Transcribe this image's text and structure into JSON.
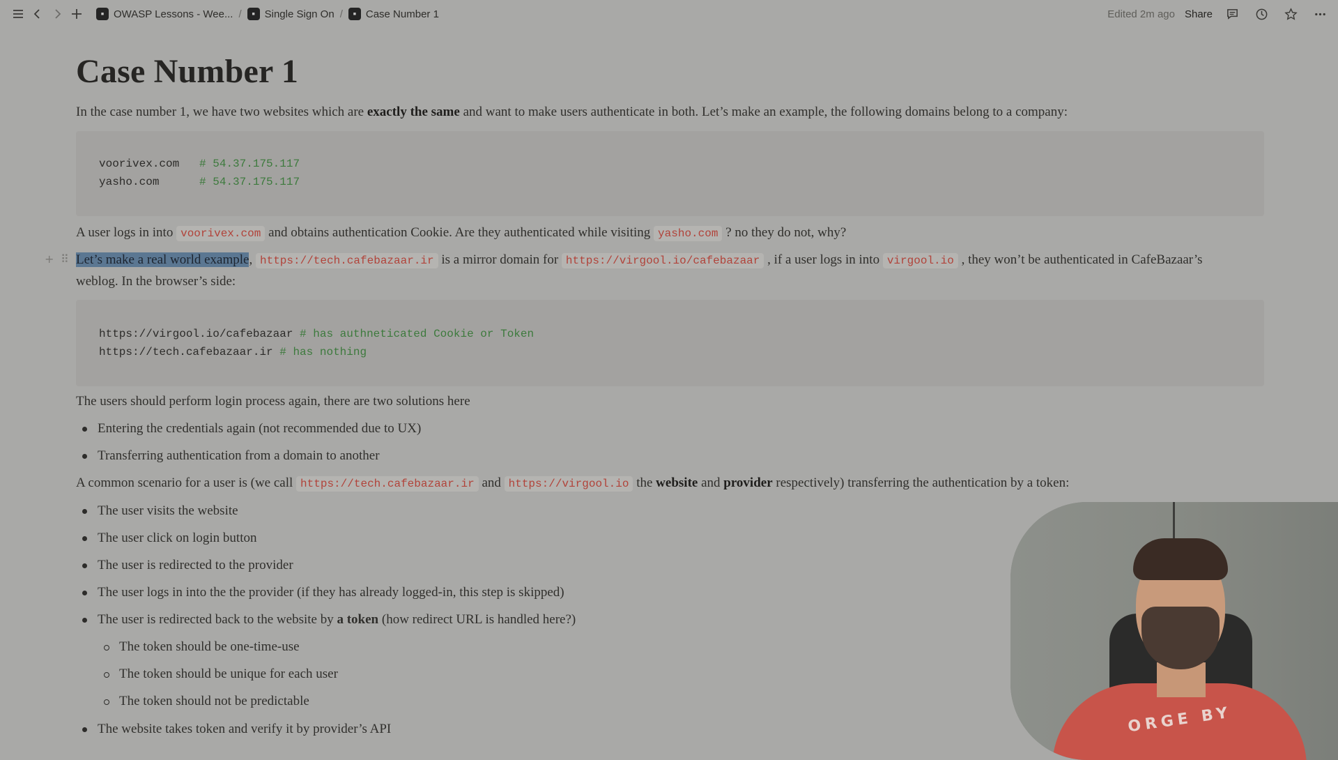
{
  "topbar": {
    "breadcrumbs": [
      {
        "icon": "notion-page-icon",
        "label": "OWASP Lessons - Wee..."
      },
      {
        "icon": "notion-page-icon",
        "label": "Single Sign On"
      },
      {
        "icon": "notion-page-icon",
        "label": "Case Number 1"
      }
    ],
    "separator": "/",
    "edited": "Edited 2m ago",
    "share": "Share",
    "icons": [
      "sidebar-toggle-icon",
      "back-icon",
      "forward-icon",
      "add-icon",
      "comments-icon",
      "history-icon",
      "favorite-star-icon",
      "more-icon"
    ]
  },
  "page": {
    "title": "Case Number 1",
    "intro": {
      "t1": "In the case number 1, we have two websites which are ",
      "b1": "exactly the same",
      "t2": " and want to make users authenticate in both. Let’s make an example, the following domains belong to a company:"
    },
    "code1": {
      "line1": {
        "code": "voorivex.com   ",
        "comment": "# 54.37.175.117"
      },
      "line2": {
        "code": "yasho.com      ",
        "comment": "# 54.37.175.117"
      }
    },
    "p2": {
      "t1": "A user logs in into ",
      "c1": "voorivex.com",
      "t2": " and obtains authentication Cookie. Are they authenticated while visiting ",
      "c2": "yasho.com",
      "t3": " ? no they do not, why?"
    },
    "p3": {
      "hl": "Let’s make a real world example",
      "t1": ", ",
      "c1": "https://tech.cafebazaar.ir",
      "t2": " is a mirror domain for ",
      "c2": "https://virgool.io/cafebazaar",
      "t3": " , if a user logs in into ",
      "c3": "virgool.io",
      "t4": " , they won’t be authenticated in CafeBazaar’s",
      "t5": "weblog. In the browser’s side:"
    },
    "code2": {
      "line1": {
        "code": "https://virgool.io/cafebazaar ",
        "comment": "# has authneticated Cookie or Token"
      },
      "line2": {
        "code": "https://tech.cafebazaar.ir ",
        "comment": "# has nothing"
      }
    },
    "p4": "The users should perform login process again, there are two solutions here",
    "list1": [
      "Entering the credentials again (not recommended due to UX)",
      "Transferring authentication from a domain to another"
    ],
    "p5": {
      "t1": "A common scenario for a user is (we call ",
      "c1": "https://tech.cafebazaar.ir",
      "t2": " and ",
      "c2": "https://virgool.io",
      "t3": " the ",
      "b1": "website",
      "t4": " and ",
      "b2": "provider",
      "t5": " respectively) transferring the authentication by a token:"
    },
    "list2": [
      "The user visits the website",
      "The user click on login button",
      "The user is redirected to the provider",
      "The user logs in into the the provider (if they has already logged-in, this step is skipped)"
    ],
    "list2_item5": {
      "t1": "The user is redirected back to the website by ",
      "b1": "a token",
      "t2": " (how redirect URL is handled here?)"
    },
    "sublist": [
      "The token should be one-time-use",
      "The token should be unique for each user",
      "The token should not be predictable"
    ],
    "list3": [
      "The website takes token and verify it by provider’s API"
    ]
  },
  "webcam": {
    "shirt_text": "ORGE BY"
  }
}
